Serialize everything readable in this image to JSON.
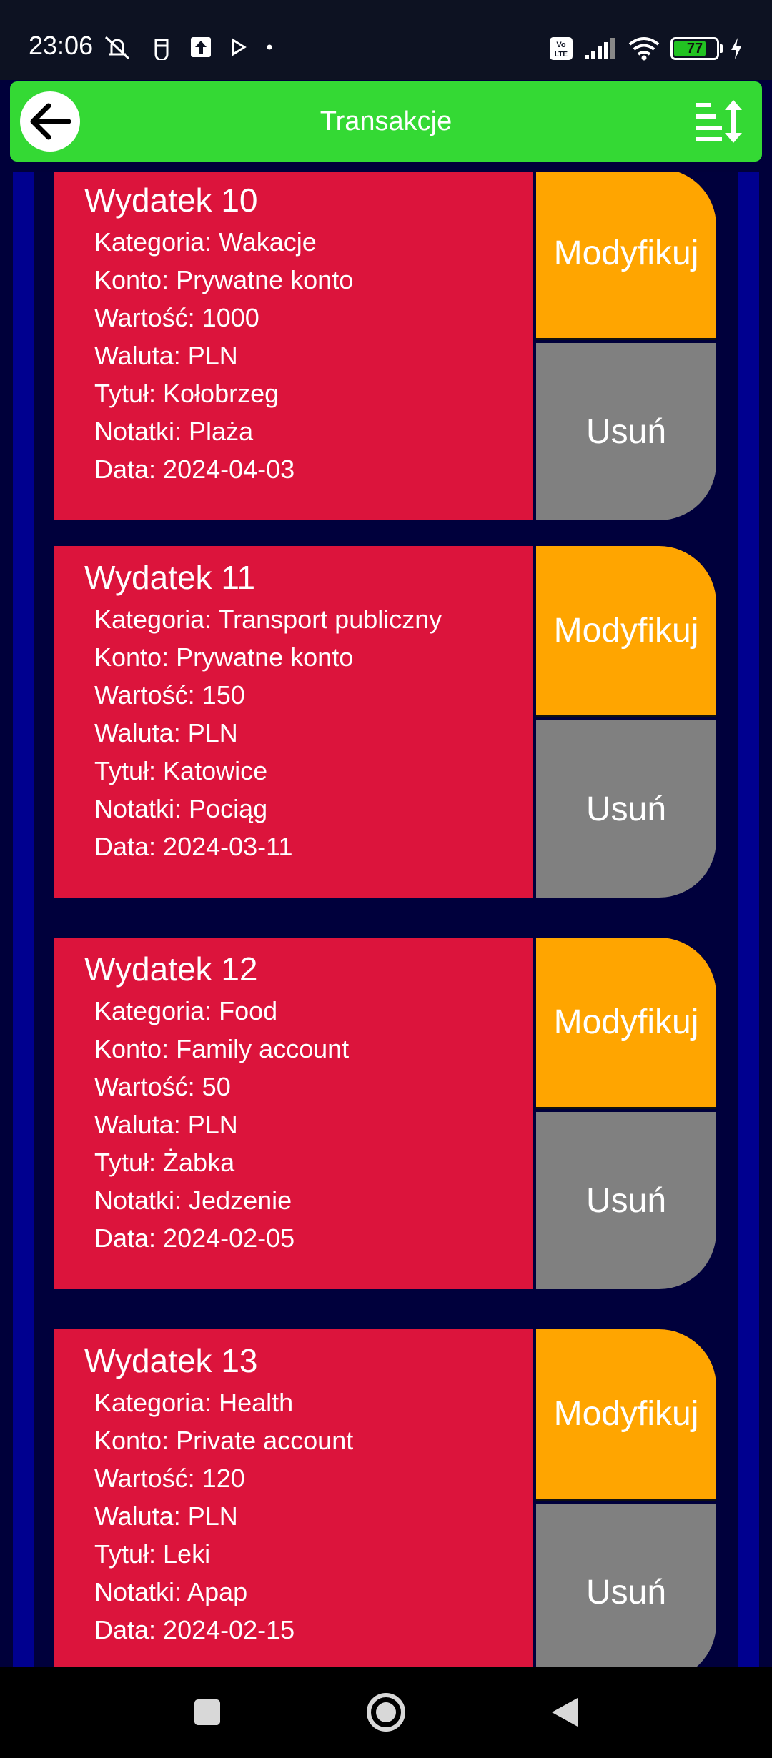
{
  "status_bar": {
    "time": "23:06",
    "icons_left": [
      "mute-icon",
      "notification-icon",
      "upload-icon",
      "play-icon",
      "dot-icon"
    ],
    "icons_right": [
      "volte-icon",
      "signal-icon",
      "wifi-icon",
      "battery-icon",
      "charging-icon"
    ],
    "network_label": "Vo LTE",
    "battery_level": "77"
  },
  "app_bar": {
    "title": "Transakcje",
    "back_icon": "arrow-left-icon",
    "sort_icon": "sort-icon",
    "color": "#34d934"
  },
  "transactions": [
    {
      "title": "Wydatek 10",
      "category": "Kategoria: Wakacje",
      "account": "Konto: Prywatne konto",
      "value": "Wartość: 1000",
      "currency": "Waluta: PLN",
      "name": "Tytuł: Kołobrzeg",
      "notes": "Notatki: Plaża",
      "date": "Data: 2024-04-03",
      "modify_label": "Modyfikuj",
      "delete_label": "Usuń"
    },
    {
      "title": "Wydatek 11",
      "category": "Kategoria: Transport publiczny",
      "account": "Konto: Prywatne konto",
      "value": "Wartość: 150",
      "currency": "Waluta: PLN",
      "name": "Tytuł: Katowice",
      "notes": "Notatki: Pociąg",
      "date": "Data: 2024-03-11",
      "modify_label": "Modyfikuj",
      "delete_label": "Usuń"
    },
    {
      "title": "Wydatek 12",
      "category": "Kategoria: Food",
      "account": "Konto: Family account",
      "value": "Wartość: 50",
      "currency": "Waluta: PLN",
      "name": "Tytuł: Żabka",
      "notes": "Notatki: Jedzenie",
      "date": "Data: 2024-02-05",
      "modify_label": "Modyfikuj",
      "delete_label": "Usuń"
    },
    {
      "title": "Wydatek 13",
      "category": "Kategoria: Health",
      "account": "Konto: Private account",
      "value": "Wartość: 120",
      "currency": "Waluta: PLN",
      "name": "Tytuł: Leki",
      "notes": "Notatki: Apap",
      "date": "Data: 2024-02-15",
      "modify_label": "Modyfikuj",
      "delete_label": "Usuń"
    }
  ],
  "colors": {
    "card_background": "#dc143c",
    "modify_button": "#ffa500",
    "delete_button": "#808080",
    "list_frame": "#00008f",
    "list_background": "#00003c"
  },
  "nav_bar": {
    "recents_icon": "square-icon",
    "home_icon": "circle-icon",
    "back_icon": "triangle-back-icon"
  }
}
